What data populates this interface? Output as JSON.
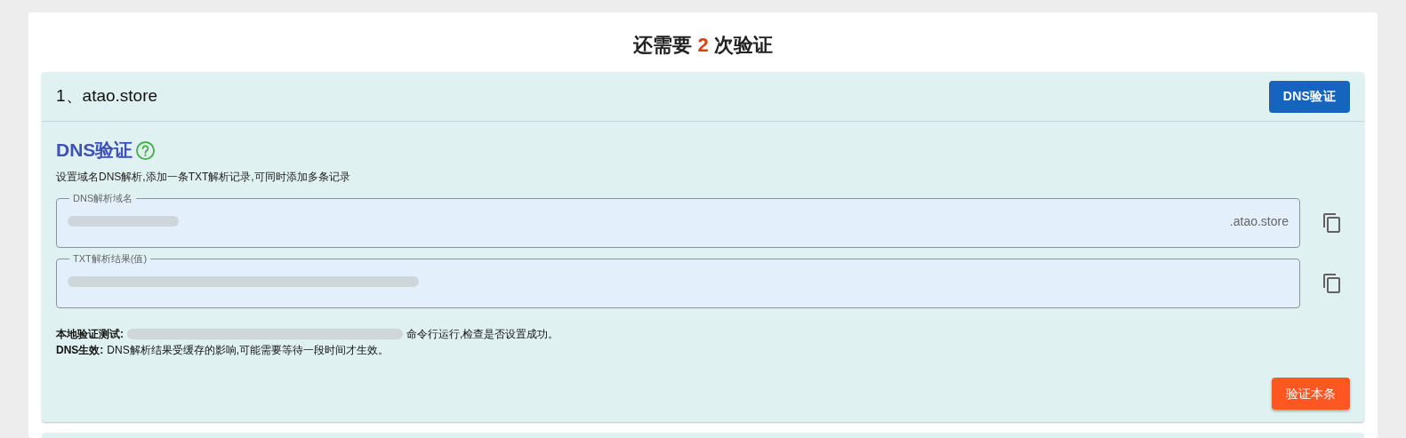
{
  "heading": {
    "prefix": "还需要",
    "count": "2",
    "suffix": "次验证"
  },
  "records": [
    {
      "index_label": "1、atao.store",
      "method_button": "DNS验证",
      "section_title": "DNS验证",
      "description": "设置域名DNS解析,添加一条TXT解析记录,可同时添加多条记录",
      "fields": [
        {
          "label": "DNS解析域名",
          "suffix": ".atao.store",
          "redacted": true
        },
        {
          "label": "TXT解析结果(值)",
          "redacted": true
        }
      ],
      "notes": [
        {
          "label": "本地验证测试:",
          "text": "命令行运行,检查是否设置成功。",
          "redacted": true
        },
        {
          "label": "DNS生效:",
          "text": "DNS解析结果受缓存的影响,可能需要等待一段时间才生效。",
          "redacted": false
        }
      ],
      "verify_button": "验证本条"
    }
  ]
}
